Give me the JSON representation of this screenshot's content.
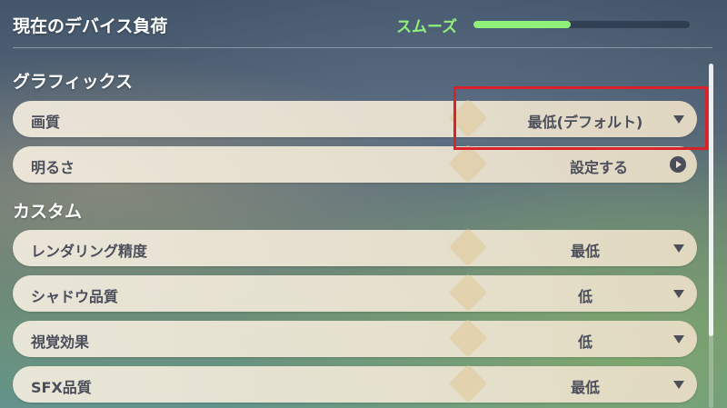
{
  "header": {
    "title": "現在のデバイス負荷",
    "load_label": "スムーズ",
    "load_level": 0.45,
    "load_color": "#8ff07a"
  },
  "sections": {
    "graphics": {
      "title": "グラフィックス",
      "quality": {
        "label": "画質",
        "value": "最低(デフォルト)",
        "icon": "chevron-down-icon"
      },
      "brightness": {
        "label": "明るさ",
        "value": "設定する",
        "icon": "arrow-right-circle-icon"
      }
    },
    "custom": {
      "title": "カスタム",
      "render_resolution": {
        "label": "レンダリング精度",
        "value": "最低",
        "icon": "chevron-down-icon"
      },
      "shadow_quality": {
        "label": "シャドウ品質",
        "value": "低",
        "icon": "chevron-down-icon"
      },
      "visual_effects": {
        "label": "視覚効果",
        "value": "低",
        "icon": "chevron-down-icon"
      },
      "sfx_quality": {
        "label": "SFX品質",
        "value": "最低",
        "icon": "chevron-down-icon"
      }
    }
  },
  "highlight_color": "#d9232a"
}
